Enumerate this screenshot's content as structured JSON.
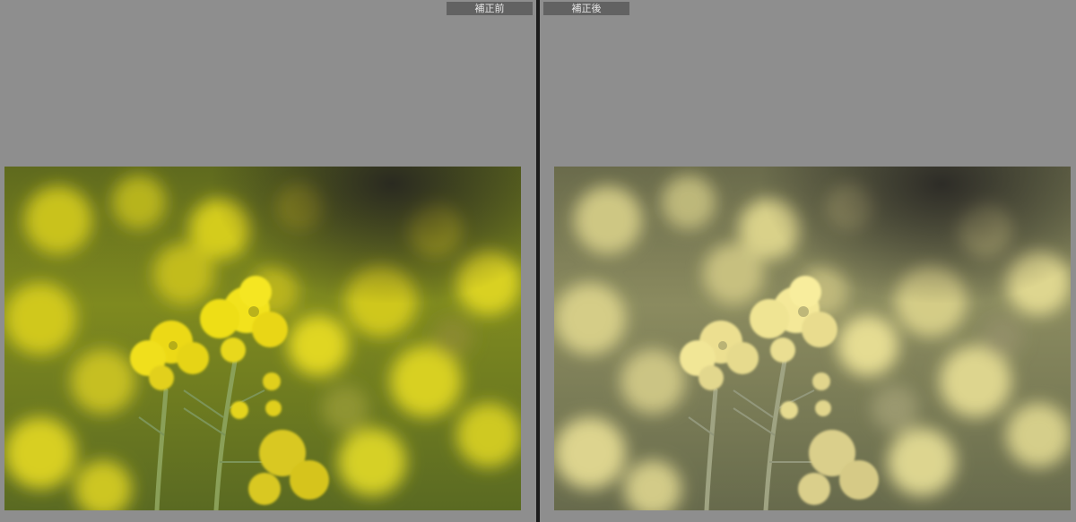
{
  "compare": {
    "before": {
      "label": "補正前"
    },
    "after": {
      "label": "補正後"
    }
  },
  "photo": {
    "subject": "canola-flower-photo"
  }
}
